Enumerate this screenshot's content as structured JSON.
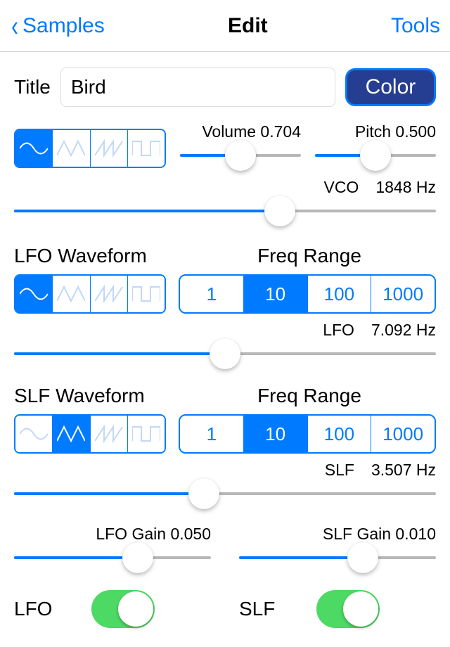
{
  "nav": {
    "back": "Samples",
    "title": "Edit",
    "tools": "Tools"
  },
  "title_row": {
    "label": "Title",
    "value": "Bird",
    "color_btn": "Color"
  },
  "primary_waveform": {
    "selected": 0
  },
  "volume": {
    "label": "Volume 0.704",
    "pct": 50
  },
  "pitch": {
    "label": "Pitch 0.500",
    "pct": 50
  },
  "vco": {
    "name": "VCO",
    "value_text": "1848 Hz",
    "pct": 63
  },
  "lfo": {
    "heading": "LFO Waveform",
    "freq_heading": "Freq Range",
    "waveform_selected": 0,
    "range_options": [
      "1",
      "10",
      "100",
      "1000"
    ],
    "range_selected": 1,
    "name": "LFO",
    "value_text": "7.092 Hz",
    "pct": 50
  },
  "slf": {
    "heading": "SLF Waveform",
    "freq_heading": "Freq Range",
    "waveform_selected": 1,
    "range_options": [
      "1",
      "10",
      "100",
      "1000"
    ],
    "range_selected": 1,
    "name": "SLF",
    "value_text": "3.507 Hz",
    "pct": 45
  },
  "lfo_gain": {
    "label": "LFO Gain 0.050",
    "pct": 63
  },
  "slf_gain": {
    "label": "SLF Gain 0.010",
    "pct": 63
  },
  "sw_lfo": {
    "label": "LFO",
    "on": true
  },
  "sw_slf": {
    "label": "SLF",
    "on": true
  }
}
